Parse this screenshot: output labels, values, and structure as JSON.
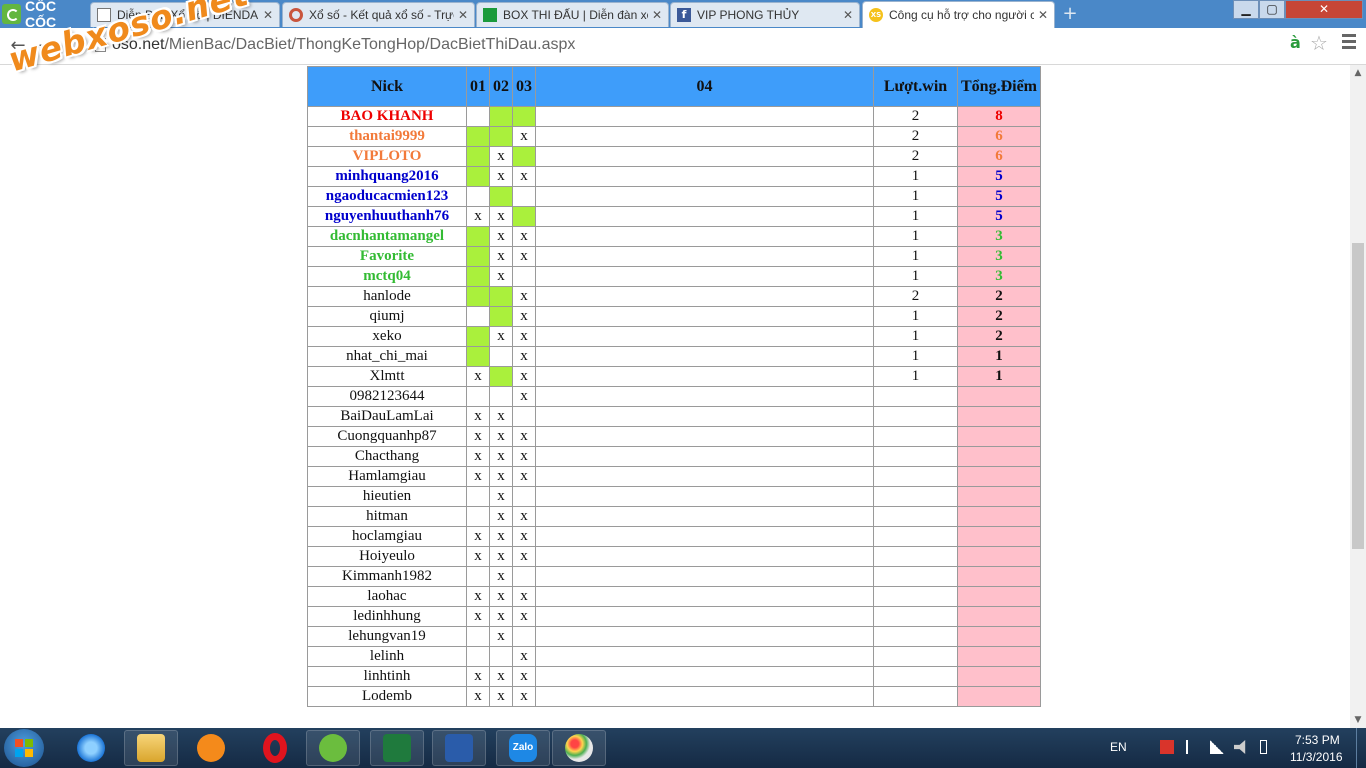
{
  "browser": {
    "brand": "CỐC CỐC",
    "tabs": [
      {
        "title": "Diễn Đàn Xổ Số | DIENDAN XOSO",
        "icon": "document-icon"
      },
      {
        "title": "Xổ số - Kết quả xổ số - Trực tiếp",
        "icon": "ring-icon"
      },
      {
        "title": "BOX THI ĐẤU | Diễn đàn xổ số",
        "icon": "green-square-icon"
      },
      {
        "title": "VIP PHONG THỦY",
        "icon": "facebook-icon"
      },
      {
        "title": "Công cụ hỗ trợ cho người chơi",
        "icon": "xs-icon",
        "active": true
      }
    ],
    "window_controls": {
      "minimize": "▁",
      "maximize": "▢",
      "close": "✕"
    },
    "nav": {
      "back": "←",
      "forward": "→",
      "reload": "↻"
    },
    "address": {
      "host": "oso.net",
      "path": "/MienBac/DacBiet/ThongKeTongHop/DacBietThiDau.aspx"
    },
    "ext_icon": "à",
    "bookmark_icon": "☆"
  },
  "watermark": "webxoso.net",
  "table": {
    "headers": {
      "nick": "Nick",
      "r1": "01",
      "r2": "02",
      "r3": "03",
      "r4": "04",
      "wins": "Lượt.win",
      "points": "Tổng.Điểm"
    },
    "mark": "x",
    "colors": {
      "header": "#3e9dfa",
      "hit": "#aaf03c",
      "points_bg": "#ffc0cb",
      "red": "#ee0000",
      "orange": "#f27a3a",
      "blue": "#0000cc",
      "green": "#33bb33"
    },
    "rows": [
      {
        "nick": "BAO KHANH",
        "color": "red",
        "r": [
          "",
          "g",
          "g"
        ],
        "wins": "2",
        "points": "8"
      },
      {
        "nick": "thantai9999",
        "color": "orange",
        "r": [
          "g",
          "g",
          "x"
        ],
        "wins": "2",
        "points": "6"
      },
      {
        "nick": "VIPLOTO",
        "color": "orange",
        "r": [
          "g",
          "x",
          "g"
        ],
        "wins": "2",
        "points": "6"
      },
      {
        "nick": "minhquang2016",
        "color": "blue",
        "r": [
          "g",
          "x",
          "x"
        ],
        "wins": "1",
        "points": "5"
      },
      {
        "nick": "ngaoducacmien123",
        "color": "blue",
        "r": [
          "",
          "g",
          ""
        ],
        "wins": "1",
        "points": "5"
      },
      {
        "nick": "nguyenhuuthanh76",
        "color": "blue",
        "r": [
          "x",
          "x",
          "g"
        ],
        "wins": "1",
        "points": "5"
      },
      {
        "nick": "dacnhantamangel",
        "color": "green",
        "r": [
          "g",
          "x",
          "x"
        ],
        "wins": "1",
        "points": "3"
      },
      {
        "nick": "Favorite",
        "color": "green",
        "r": [
          "g",
          "x",
          "x"
        ],
        "wins": "1",
        "points": "3"
      },
      {
        "nick": "mctq04",
        "color": "green",
        "r": [
          "g",
          "x",
          ""
        ],
        "wins": "1",
        "points": "3"
      },
      {
        "nick": "hanlode",
        "color": "",
        "r": [
          "g",
          "g",
          "x"
        ],
        "wins": "2",
        "points": "2"
      },
      {
        "nick": "qiumj",
        "color": "",
        "r": [
          "",
          "g",
          "x"
        ],
        "wins": "1",
        "points": "2"
      },
      {
        "nick": "xeko",
        "color": "",
        "r": [
          "g",
          "x",
          "x"
        ],
        "wins": "1",
        "points": "2"
      },
      {
        "nick": "nhat_chi_mai",
        "color": "",
        "r": [
          "g",
          "",
          "x"
        ],
        "wins": "1",
        "points": "1"
      },
      {
        "nick": "Xlmtt",
        "color": "",
        "r": [
          "x",
          "g",
          "x"
        ],
        "wins": "1",
        "points": "1"
      },
      {
        "nick": "0982123644",
        "color": "",
        "r": [
          "",
          "",
          "x"
        ],
        "wins": "",
        "points": ""
      },
      {
        "nick": "BaiDauLamLai",
        "color": "",
        "r": [
          "x",
          "x",
          ""
        ],
        "wins": "",
        "points": ""
      },
      {
        "nick": "Cuongquanhp87",
        "color": "",
        "r": [
          "x",
          "x",
          "x"
        ],
        "wins": "",
        "points": ""
      },
      {
        "nick": "Chacthang",
        "color": "",
        "r": [
          "x",
          "x",
          "x"
        ],
        "wins": "",
        "points": ""
      },
      {
        "nick": "Hamlamgiau",
        "color": "",
        "r": [
          "x",
          "x",
          "x"
        ],
        "wins": "",
        "points": ""
      },
      {
        "nick": "hieutien",
        "color": "",
        "r": [
          "",
          "x",
          ""
        ],
        "wins": "",
        "points": ""
      },
      {
        "nick": "hitman",
        "color": "",
        "r": [
          "",
          "x",
          "x"
        ],
        "wins": "",
        "points": ""
      },
      {
        "nick": "hoclamgiau",
        "color": "",
        "r": [
          "x",
          "x",
          "x"
        ],
        "wins": "",
        "points": ""
      },
      {
        "nick": "Hoiyeulo",
        "color": "",
        "r": [
          "x",
          "x",
          "x"
        ],
        "wins": "",
        "points": ""
      },
      {
        "nick": "Kimmanh1982",
        "color": "",
        "r": [
          "",
          "x",
          ""
        ],
        "wins": "",
        "points": ""
      },
      {
        "nick": "laohac",
        "color": "",
        "r": [
          "x",
          "x",
          "x"
        ],
        "wins": "",
        "points": ""
      },
      {
        "nick": "ledinhhung",
        "color": "",
        "r": [
          "x",
          "x",
          "x"
        ],
        "wins": "",
        "points": ""
      },
      {
        "nick": "lehungvan19",
        "color": "",
        "r": [
          "",
          "x",
          ""
        ],
        "wins": "",
        "points": ""
      },
      {
        "nick": "lelinh",
        "color": "",
        "r": [
          "",
          "",
          "x"
        ],
        "wins": "",
        "points": ""
      },
      {
        "nick": "linhtinh",
        "color": "",
        "r": [
          "x",
          "x",
          "x"
        ],
        "wins": "",
        "points": ""
      },
      {
        "nick": "Lodemb",
        "color": "",
        "r": [
          "x",
          "x",
          "x"
        ],
        "wins": "",
        "points": ""
      }
    ]
  },
  "taskbar": {
    "apps": [
      "internet-explorer-icon",
      "file-explorer-icon",
      "media-player-icon",
      "opera-icon",
      "coccoc-icon",
      "excel-icon",
      "word-icon",
      "zalo-icon",
      "paint-icon"
    ],
    "zalo_label": "Zalo",
    "language": "EN",
    "time": "7:53 PM",
    "date": "11/3/2016"
  }
}
